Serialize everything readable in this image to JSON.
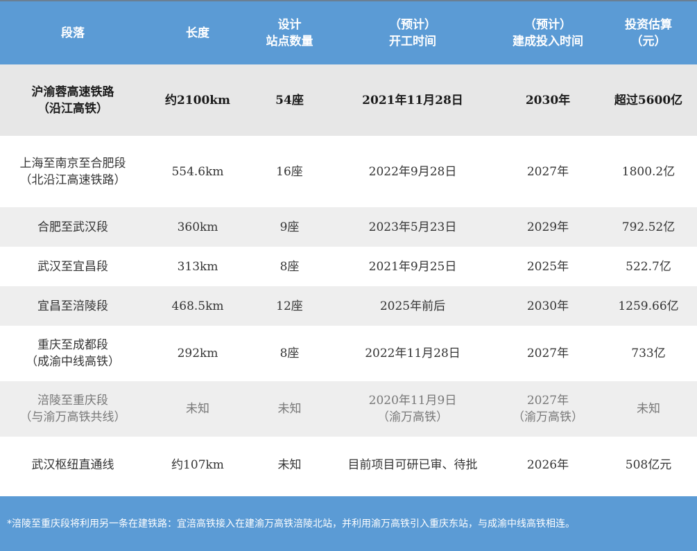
{
  "colors": {
    "header_bg": "#5b9bd5",
    "highlight_row_bg": "#e7e7e7",
    "alt_row_bg": "#eeeeee",
    "footer_bg": "#5b9bd5"
  },
  "table": {
    "headers": [
      [
        "段落"
      ],
      [
        "长度"
      ],
      [
        "设计",
        "站点数量"
      ],
      [
        "（预计）",
        "开工时间"
      ],
      [
        "（预计）",
        "建成投入时间"
      ],
      [
        "投资估算",
        "（元）"
      ]
    ],
    "rows": [
      {
        "segment": [
          "沪渝蓉高速铁路",
          "（沿江高铁）"
        ],
        "length": [
          "约2100km"
        ],
        "stations": [
          "54座"
        ],
        "start": [
          "2021年11月28日"
        ],
        "complete": [
          "2030年"
        ],
        "investment": [
          "超过5600亿"
        ]
      },
      {
        "segment": [
          "上海至南京至合肥段",
          "（北沿江高速铁路）"
        ],
        "length": [
          "554.6km"
        ],
        "stations": [
          "16座"
        ],
        "start": [
          "2022年9月28日"
        ],
        "complete": [
          "2027年"
        ],
        "investment": [
          "1800.2亿"
        ]
      },
      {
        "segment": [
          "合肥至武汉段"
        ],
        "length": [
          "360km"
        ],
        "stations": [
          "9座"
        ],
        "start": [
          "2023年5月23日"
        ],
        "complete": [
          "2029年"
        ],
        "investment": [
          "792.52亿"
        ]
      },
      {
        "segment": [
          "武汉至宜昌段"
        ],
        "length": [
          "313km"
        ],
        "stations": [
          "8座"
        ],
        "start": [
          "2021年9月25日"
        ],
        "complete": [
          "2025年"
        ],
        "investment": [
          "522.7亿"
        ]
      },
      {
        "segment": [
          "宜昌至涪陵段"
        ],
        "length": [
          "468.5km"
        ],
        "stations": [
          "12座"
        ],
        "start": [
          "2025年前后"
        ],
        "complete": [
          "2030年"
        ],
        "investment": [
          "1259.66亿"
        ]
      },
      {
        "segment": [
          "重庆至成都段",
          "（成渝中线高铁）"
        ],
        "length": [
          "292km"
        ],
        "stations": [
          "8座"
        ],
        "start": [
          "2022年11月28日"
        ],
        "complete": [
          "2027年"
        ],
        "investment": [
          "733亿"
        ]
      },
      {
        "segment": [
          "涪陵至重庆段",
          "（与渝万高铁共线）"
        ],
        "length": [
          "未知"
        ],
        "stations": [
          "未知"
        ],
        "start": [
          "2020年11月9日",
          "（渝万高铁）"
        ],
        "complete": [
          "2027年",
          "（渝万高铁）"
        ],
        "investment": [
          "未知"
        ]
      },
      {
        "segment": [
          "武汉枢纽直通线"
        ],
        "length": [
          "约107km"
        ],
        "stations": [
          "未知"
        ],
        "start": [
          "目前项目可研已审、待批"
        ],
        "complete": [
          "2026年"
        ],
        "investment": [
          "508亿元"
        ]
      }
    ]
  },
  "footer": {
    "note": "*涪陵至重庆段将利用另一条在建铁路：宜涪高铁接入在建渝万高铁涪陵北站，并利用渝万高铁引入重庆东站，与成渝中线高铁相连。"
  }
}
